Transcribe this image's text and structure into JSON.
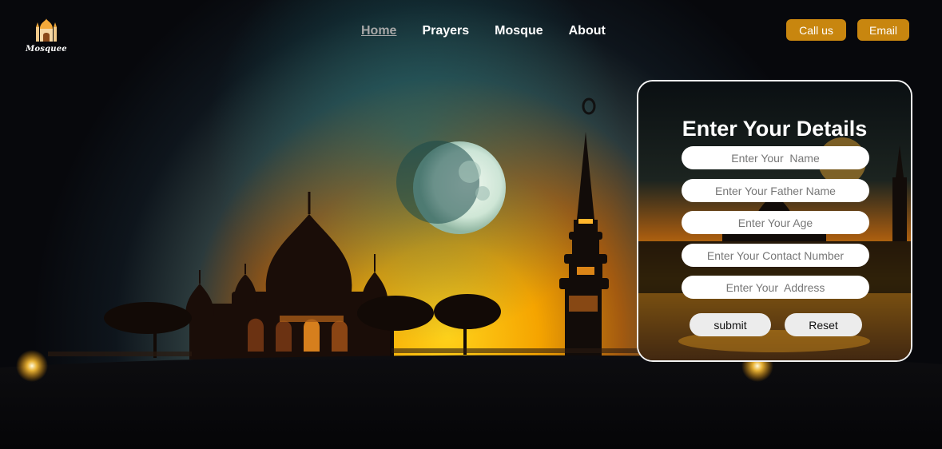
{
  "brand": {
    "logo_icon": "mosque-icon",
    "name": "Mosquee"
  },
  "nav": {
    "items": [
      {
        "label": "Home",
        "active": true
      },
      {
        "label": "Prayers",
        "active": false
      },
      {
        "label": "Mosque",
        "active": false
      },
      {
        "label": "About",
        "active": false
      }
    ]
  },
  "actions": {
    "call_label": "Call us",
    "email_label": "Email"
  },
  "form": {
    "title": "Enter Your Details",
    "fields": {
      "name_placeholder": "Enter Your  Name",
      "father_placeholder": "Enter Your Father Name",
      "age_placeholder": "Enter Your Age",
      "contact_placeholder": "Enter Your Contact Number",
      "address_placeholder": "Enter Your  Address"
    },
    "submit_label": "submit",
    "reset_label": "Reset"
  },
  "colors": {
    "accent": "#c8860f",
    "sky_top": "#0b0d14",
    "horizon_glow": "#f5b400",
    "card_border": "#f2f2f2"
  }
}
